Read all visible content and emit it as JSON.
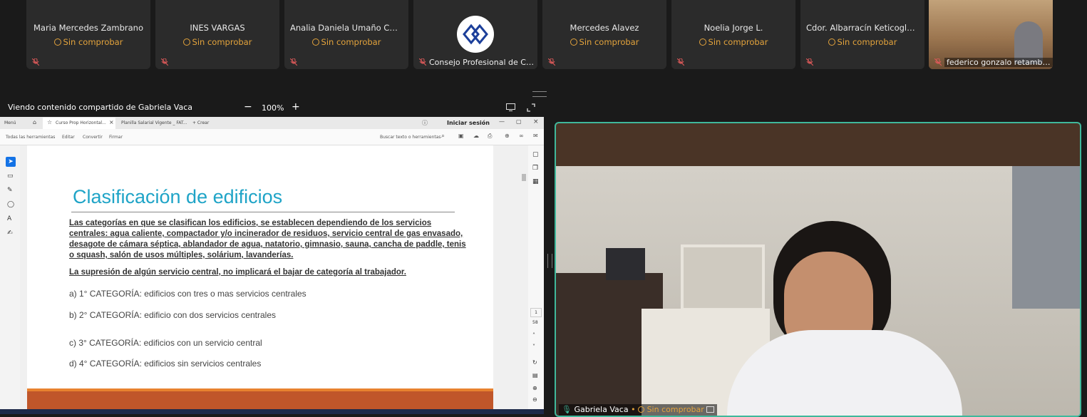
{
  "participants": [
    {
      "name": "Maria Mercedes Zambrano",
      "status": "Sin comprobar"
    },
    {
      "name": "INES VARGAS",
      "status": "Sin comprobar"
    },
    {
      "name": "Analia Daniela Umaño Chilo",
      "status": "Sin comprobar"
    },
    {
      "bottom_name": "Consejo Profesional de Cie..."
    },
    {
      "name": "Mercedes Alavez",
      "status": "Sin comprobar"
    },
    {
      "name": "Noelia Jorge L.",
      "status": "Sin comprobar"
    },
    {
      "name": "Cdor. Albarracín Keticoglu Jua...",
      "status": "Sin comprobar"
    },
    {
      "bottom_name": "federico gonzalo retambay ..."
    }
  ],
  "share": {
    "label": "Viendo contenido compartido de Gabriela Vaca",
    "zoom": "100%",
    "minus": "−",
    "plus": "+"
  },
  "viewer": {
    "menu": "Menú",
    "tabs": [
      "Curso Prop Horizontal...",
      "Planilla Salarial Vigente _ FAT..."
    ],
    "new_tab": "+ Crear",
    "signin": "Iniciar sesión",
    "tools": [
      "Todas las herramientas",
      "Editar",
      "Convertir",
      "Firmar"
    ],
    "search": "Buscar texto o herramientas",
    "page_num": "1",
    "page_total": "58"
  },
  "slide": {
    "title": "Clasificación de edificios",
    "para1": "Las categorías en que se clasifican los edificios, se establecen dependiendo de los servicios centrales: agua caliente, compactador y/o incinerador de residuos, servicio central de gas envasado, desagote de cámara séptica, ablandador de agua, natatorio, gimnasio, sauna, cancha de paddle, tenis o squash, salón de usos múltiples, solárium, lavanderías.",
    "para2": "La supresión de algún servicio central, no implicará el bajar de categoría al trabajador.",
    "items": [
      "a) 1° CATEGORÍA: edificios con tres o mas servicios centrales",
      "b) 2° CATEGORÍA: edificio con dos servicios centrales",
      "c) 3° CATEGORÍA: edificios con un servicio central",
      "d) 4° CATEGORÍA: edificios sin servicios centrales"
    ]
  },
  "speaker": {
    "name": "Gabriela Vaca",
    "status": "Sin comprobar"
  },
  "colors": {
    "status": "#e3a33c",
    "title": "#1fa4c7",
    "active_border": "#3fb89b"
  }
}
